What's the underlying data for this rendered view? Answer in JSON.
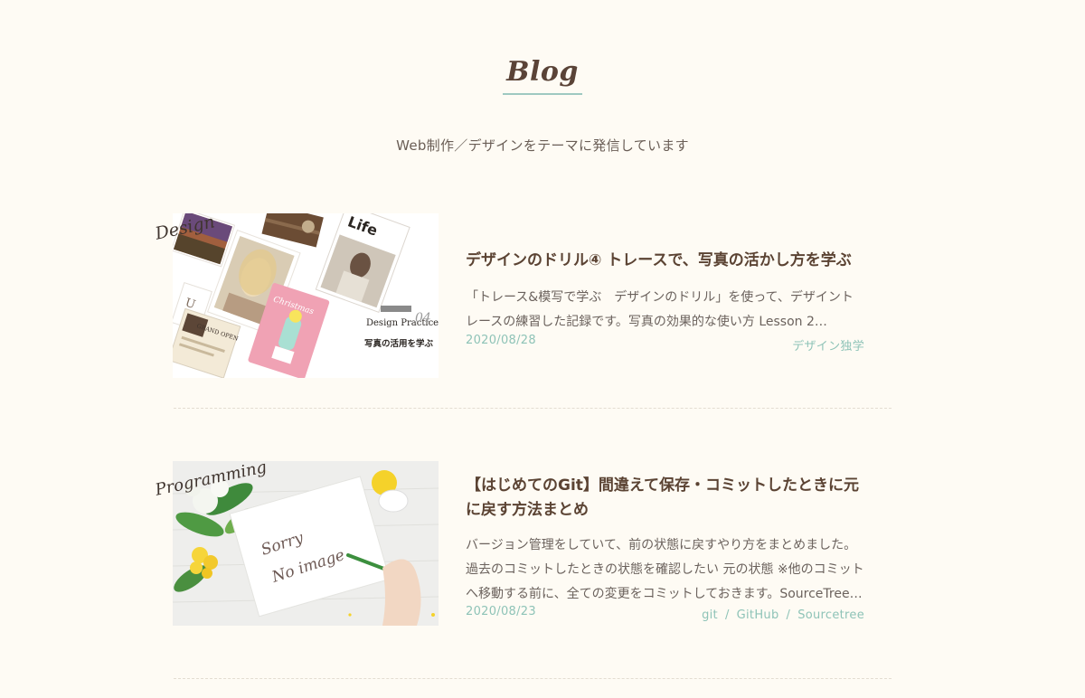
{
  "section": {
    "title": "Blog",
    "lead": "Web制作／デザインをテーマに発信しています"
  },
  "posts": [
    {
      "category_label": "Design",
      "thumbnail_overlay": {
        "life": "Life",
        "practice": "Design Practice",
        "practice_num": "04",
        "practice_sub": "写真の活用を学ぶ",
        "grand_open": "GRAND OPEN"
      },
      "title": "デザインのドリル④ トレースで、写真の活かし方を学ぶ",
      "excerpt": "「トレース&模写で学ぶ　デザインのドリル」を使って、デザイントレースの練習した記録です。写真の効果的な使い方 Lesson 2…",
      "date": "2020/08/28",
      "tags": [
        "デザイン独学"
      ]
    },
    {
      "category_label": "Programming",
      "thumbnail_overlay": {
        "line1": "Sorry",
        "line2": "No image"
      },
      "title": "【はじめてのGit】間違えて保存・コミットしたときに元に戻す方法まとめ",
      "excerpt": "バージョン管理をしていて、前の状態に戻すやり方をまとめました。過去のコミットしたときの状態を確認したい 元の状態 ※他のコミットへ移動する前に、全ての変更をコミットしておきます。SourceTree…",
      "date": "2020/08/23",
      "tags": [
        "git",
        "GitHub",
        "Sourcetree"
      ]
    }
  ],
  "colors": {
    "background": "#fefbf4",
    "accent": "#8ec3b7",
    "title": "#5b4333",
    "text": "#6b625d"
  }
}
